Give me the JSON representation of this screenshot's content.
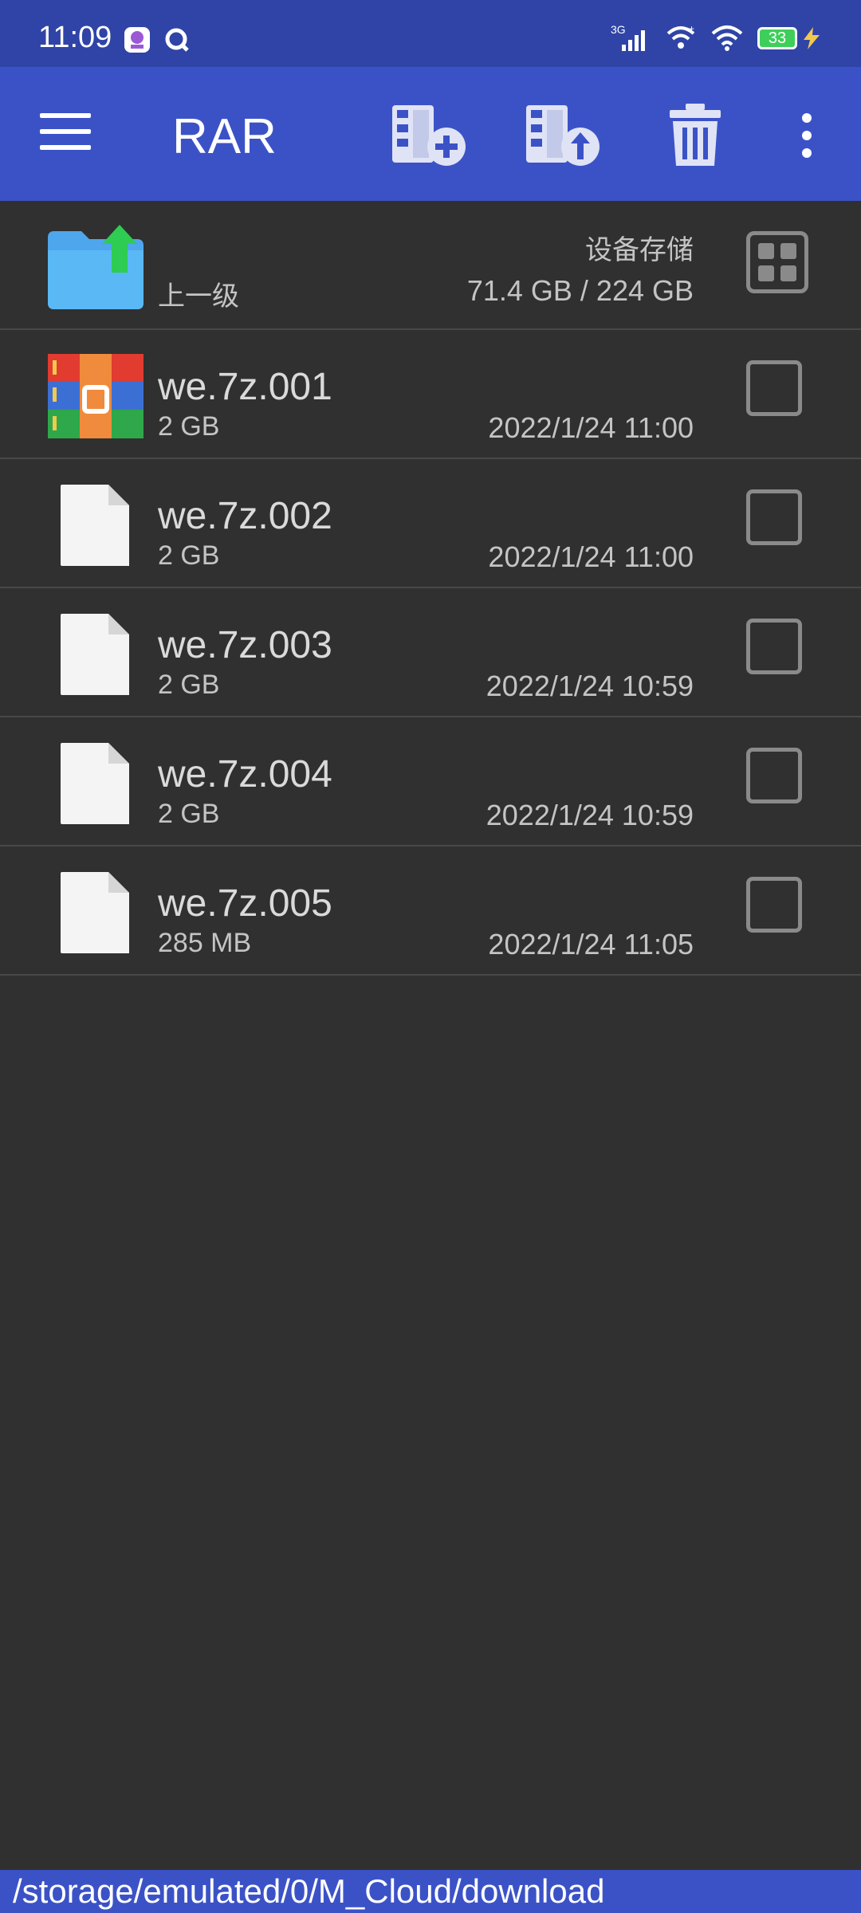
{
  "status_bar": {
    "time": "11:09",
    "network": "3G",
    "battery": "33"
  },
  "app_bar": {
    "title": "RAR"
  },
  "parent_row": {
    "label": "上一级",
    "storage_name": "设备存储",
    "storage_usage": "71.4 GB / 224 GB"
  },
  "files": [
    {
      "name": "we.7z.001",
      "size": "2 GB",
      "date": "2022/1/24 11:00",
      "icon": "rar-archive-icon"
    },
    {
      "name": "we.7z.002",
      "size": "2 GB",
      "date": "2022/1/24 11:00",
      "icon": "blank-file-icon"
    },
    {
      "name": "we.7z.003",
      "size": "2 GB",
      "date": "2022/1/24 10:59",
      "icon": "blank-file-icon"
    },
    {
      "name": "we.7z.004",
      "size": "2 GB",
      "date": "2022/1/24 10:59",
      "icon": "blank-file-icon"
    },
    {
      "name": "we.7z.005",
      "size": "285 MB",
      "date": "2022/1/24 11:05",
      "icon": "blank-file-icon"
    }
  ],
  "path_bar": {
    "path": "/storage/emulated/0/M_Cloud/download"
  },
  "colors": {
    "status_bar": "#2f44a6",
    "app_bar": "#3b52c7",
    "background": "#303030",
    "divider": "#484848"
  }
}
